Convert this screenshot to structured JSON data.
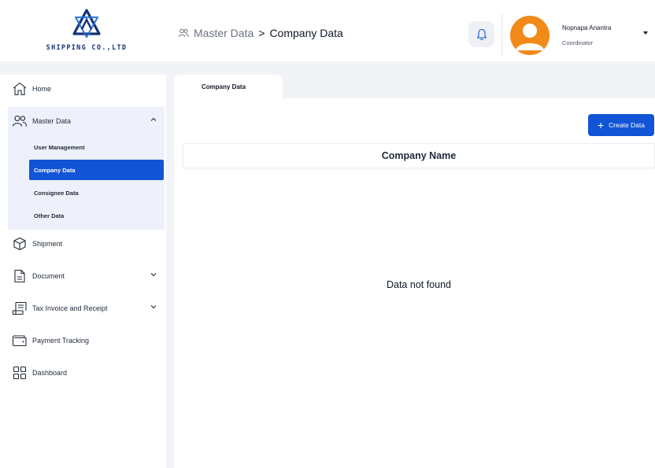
{
  "header": {
    "logo_text": "SHIPPING CO.,LTD",
    "breadcrumb": {
      "parent": "Master Data",
      "separator": ">",
      "current": "Company Data"
    },
    "user": {
      "name": "Nopnapa Anantra",
      "role": "Coordinator"
    }
  },
  "sidebar": {
    "items": [
      {
        "label": "Home",
        "icon": "home-icon"
      },
      {
        "label": "Master Data",
        "icon": "users-icon",
        "expanded": true
      },
      {
        "label": "Shipment",
        "icon": "package-icon"
      },
      {
        "label": "Document",
        "icon": "document-icon"
      },
      {
        "label": "Tax Invoice and Receipt",
        "icon": "receipt-icon"
      },
      {
        "label": "Payment Tracking",
        "icon": "wallet-icon"
      },
      {
        "label": "Dashboard",
        "icon": "dashboard-icon"
      }
    ],
    "master_sub_items": [
      {
        "label": "User Management",
        "active": false
      },
      {
        "label": "Company Data",
        "active": true
      },
      {
        "label": "Consignee Data",
        "active": false
      },
      {
        "label": "Other Data",
        "active": false
      }
    ]
  },
  "main": {
    "tab_label": "Company Data",
    "create_button": "Create Data",
    "table": {
      "columns": [
        "Company Name"
      ],
      "rows": []
    },
    "empty_message": "Data not found"
  },
  "colors": {
    "primary": "#1155d6",
    "avatar": "#f28a1a",
    "logo": "#15357a",
    "active_group_bg": "#eef1fb"
  }
}
